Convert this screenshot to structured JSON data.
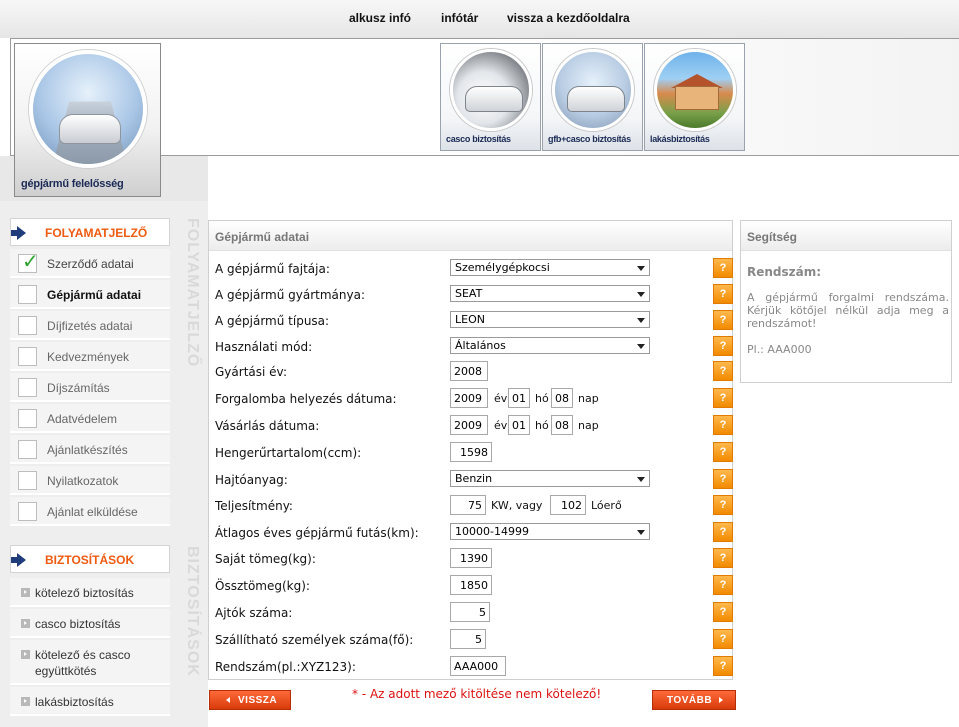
{
  "topnav": {
    "links": [
      "alkusz infó",
      "infótár",
      "vissza a kezdőoldalra"
    ]
  },
  "banner": {
    "main_tile": "gépjármű felelősség",
    "tiles": [
      "casco biztosítás",
      "gfb+casco biztosítás",
      "lakásbiztosítás"
    ]
  },
  "sidebar": {
    "progress_title": "FOLYAMATJELZŐ",
    "progress_watermark": "FOLYAMATJELZŐ",
    "progress_items": [
      {
        "label": "Szerződő adatai",
        "state": "done"
      },
      {
        "label": "Gépjármű adatai",
        "state": "active"
      },
      {
        "label": "Díjfizetés adatai",
        "state": "pending"
      },
      {
        "label": "Kedvezmények",
        "state": "pending"
      },
      {
        "label": "Díjszámítás",
        "state": "pending"
      },
      {
        "label": "Adatvédelem",
        "state": "pending"
      },
      {
        "label": "Ajánlatkészítés",
        "state": "pending"
      },
      {
        "label": "Nyilatkozatok",
        "state": "pending"
      },
      {
        "label": "Ajánlat elküldése",
        "state": "pending"
      }
    ],
    "insurance_title": "BIZTOSÍTÁSOK",
    "insurance_watermark": "BIZTOSÍTÁSOK",
    "insurance_items": [
      "kötelező biztosítás",
      "casco biztosítás",
      "kötelező és casco együttkötés",
      "lakásbiztosítás"
    ]
  },
  "form": {
    "title": "Gépjármű adatai",
    "help_symbol": "?",
    "fields": {
      "fajta": {
        "label": "A gépjármű fajtája:",
        "value": "Személygépkocsi"
      },
      "gyartmany": {
        "label": "A gépjármű gyártmánya:",
        "value": "SEAT"
      },
      "tipus": {
        "label": "A gépjármű típusa:",
        "value": "LEON"
      },
      "hasznalat": {
        "label": "Használati mód:",
        "value": "Általános"
      },
      "gyartasi_ev": {
        "label": "Gyártási év:",
        "value": "2008"
      },
      "forgalomba": {
        "label": "Forgalomba helyezés dátuma:",
        "year": "2009",
        "month": "01",
        "day": "08"
      },
      "vasarlas": {
        "label": "Vásárlás dátuma:",
        "year": "2009",
        "month": "01",
        "day": "08"
      },
      "henger": {
        "label": "Hengerűrtartalom(ccm):",
        "value": "1598"
      },
      "hajtoanyag": {
        "label": "Hajtóanyag:",
        "value": "Benzin"
      },
      "teljesitmeny": {
        "label": "Teljesítmény:",
        "kw": "75",
        "le": "102"
      },
      "futas": {
        "label": "Átlagos éves gépjármű futás(km):",
        "value": "10000-14999"
      },
      "sajat_tomeg": {
        "label": "Saját tömeg(kg):",
        "value": "1390"
      },
      "ossztomeg": {
        "label": "Össztömeg(kg):",
        "value": "1850"
      },
      "ajtok": {
        "label": "Ajtók száma:",
        "value": "5"
      },
      "szemelyek": {
        "label": "Szállítható személyek száma(fő):",
        "value": "5"
      },
      "rendszam": {
        "label": "Rendszám(pl.:XYZ123):",
        "value": "AAA000"
      }
    },
    "units": {
      "ev": "év",
      "ho": "hó",
      "nap": "nap",
      "kw_vagy": "KW, vagy",
      "loero": "Lóerő"
    }
  },
  "help_panel": {
    "title": "Segítség",
    "heading": "Rendszám:",
    "body": "A gépjármű forgalmi rendszáma. Kérjük kötőjel nélkül adja meg a rendszámot!",
    "example": "Pl.: AAA000"
  },
  "footer": {
    "back_label": "VISSZA",
    "next_label": "TOVÁBB",
    "note": "* - Az adott mező kitöltése nem kötelező!"
  },
  "colors": {
    "accent_orange": "#ee5a10",
    "button_red": "#d83a0a",
    "help_orange": "#f28a00",
    "nav_blue": "#1f3d7a",
    "note_red": "#dd1111"
  }
}
